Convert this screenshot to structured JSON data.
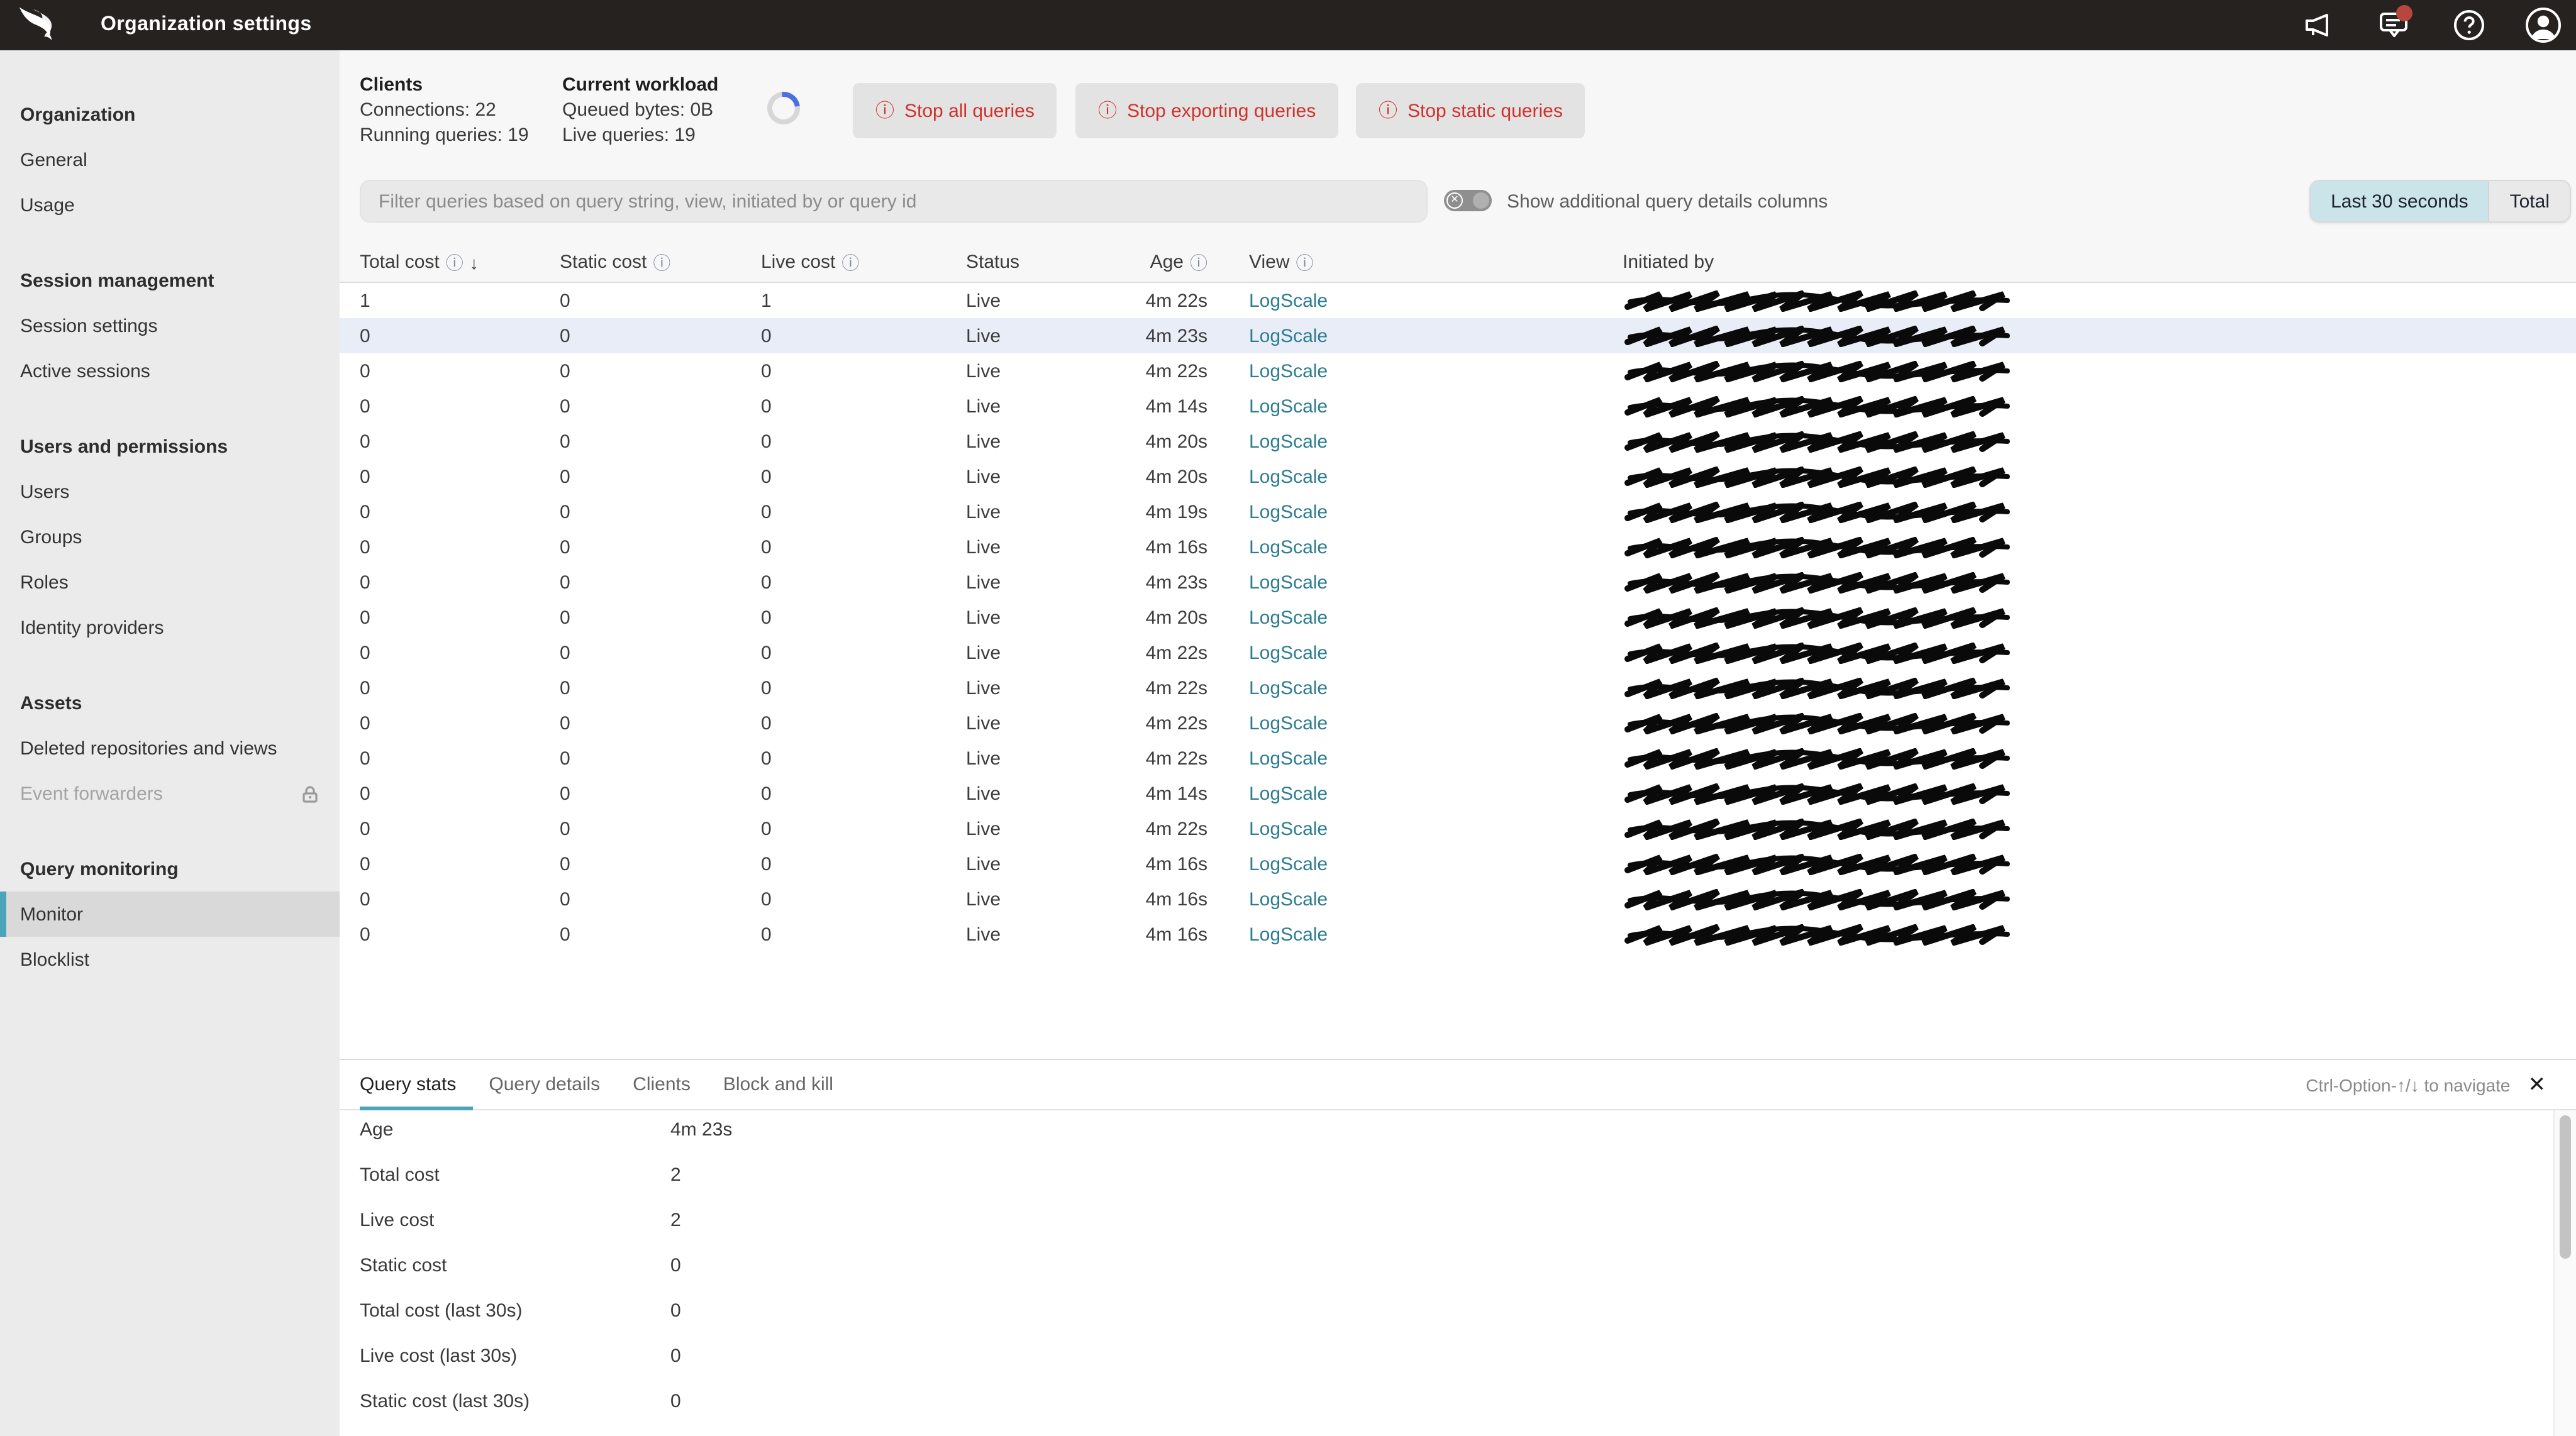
{
  "topbar": {
    "title": "Organization settings",
    "logo": "CrowdStrike falcon",
    "icons": [
      "megaphone-icon",
      "notifications-icon",
      "help-icon",
      "account-icon"
    ],
    "notifications_badge": true
  },
  "sidebar": {
    "sections": [
      {
        "header": "Organization",
        "items": [
          {
            "label": "General"
          },
          {
            "label": "Usage"
          }
        ]
      },
      {
        "header": "Session management",
        "items": [
          {
            "label": "Session settings"
          },
          {
            "label": "Active sessions"
          }
        ]
      },
      {
        "header": "Users and permissions",
        "items": [
          {
            "label": "Users"
          },
          {
            "label": "Groups"
          },
          {
            "label": "Roles"
          },
          {
            "label": "Identity providers"
          }
        ]
      },
      {
        "header": "Assets",
        "items": [
          {
            "label": "Deleted repositories and views"
          },
          {
            "label": "Event forwarders",
            "disabled": true,
            "lock": true
          }
        ]
      },
      {
        "header": "Query monitoring",
        "items": [
          {
            "label": "Monitor",
            "selected": true
          },
          {
            "label": "Blocklist"
          }
        ]
      }
    ]
  },
  "stats": {
    "clients": {
      "title": "Clients",
      "line1": "Connections: 22",
      "line2": "Running queries: 19"
    },
    "workload": {
      "title": "Current workload",
      "line1": "Queued bytes: 0B",
      "line2": "Live queries: 19"
    }
  },
  "actions": {
    "stop_all": "Stop all queries",
    "stop_exporting": "Stop exporting queries",
    "stop_static": "Stop static queries"
  },
  "filter": {
    "placeholder": "Filter queries based on query string, view, initiated by or query id"
  },
  "toggle": {
    "label": "Show additional query details columns",
    "state": "off"
  },
  "range_selector": {
    "options": [
      "Last 30 seconds",
      "Total"
    ],
    "selected": "Last 30 seconds"
  },
  "table": {
    "columns": [
      {
        "label": "Total cost",
        "info": true,
        "sort": "desc"
      },
      {
        "label": "Static cost",
        "info": true
      },
      {
        "label": "Live cost",
        "info": true
      },
      {
        "label": "Status"
      },
      {
        "label": "Age",
        "info": true
      },
      {
        "label": "View",
        "info": true
      },
      {
        "label": "Initiated by"
      }
    ],
    "selected_row_index": 1,
    "rows": [
      {
        "total": "1",
        "static": "0",
        "live": "1",
        "status": "Live",
        "age": "4m 22s",
        "view": "LogScale",
        "initiated": "redacted"
      },
      {
        "total": "0",
        "static": "0",
        "live": "0",
        "status": "Live",
        "age": "4m 23s",
        "view": "LogScale",
        "initiated": "redacted"
      },
      {
        "total": "0",
        "static": "0",
        "live": "0",
        "status": "Live",
        "age": "4m 22s",
        "view": "LogScale",
        "initiated": "redacted"
      },
      {
        "total": "0",
        "static": "0",
        "live": "0",
        "status": "Live",
        "age": "4m 14s",
        "view": "LogScale",
        "initiated": "redacted"
      },
      {
        "total": "0",
        "static": "0",
        "live": "0",
        "status": "Live",
        "age": "4m 20s",
        "view": "LogScale",
        "initiated": "redacted"
      },
      {
        "total": "0",
        "static": "0",
        "live": "0",
        "status": "Live",
        "age": "4m 20s",
        "view": "LogScale",
        "initiated": "redacted"
      },
      {
        "total": "0",
        "static": "0",
        "live": "0",
        "status": "Live",
        "age": "4m 19s",
        "view": "LogScale",
        "initiated": "redacted"
      },
      {
        "total": "0",
        "static": "0",
        "live": "0",
        "status": "Live",
        "age": "4m 16s",
        "view": "LogScale",
        "initiated": "redacted"
      },
      {
        "total": "0",
        "static": "0",
        "live": "0",
        "status": "Live",
        "age": "4m 23s",
        "view": "LogScale",
        "initiated": "redacted"
      },
      {
        "total": "0",
        "static": "0",
        "live": "0",
        "status": "Live",
        "age": "4m 20s",
        "view": "LogScale",
        "initiated": "redacted"
      },
      {
        "total": "0",
        "static": "0",
        "live": "0",
        "status": "Live",
        "age": "4m 22s",
        "view": "LogScale",
        "initiated": "redacted"
      },
      {
        "total": "0",
        "static": "0",
        "live": "0",
        "status": "Live",
        "age": "4m 22s",
        "view": "LogScale",
        "initiated": "redacted"
      },
      {
        "total": "0",
        "static": "0",
        "live": "0",
        "status": "Live",
        "age": "4m 22s",
        "view": "LogScale",
        "initiated": "redacted"
      },
      {
        "total": "0",
        "static": "0",
        "live": "0",
        "status": "Live",
        "age": "4m 22s",
        "view": "LogScale",
        "initiated": "redacted"
      },
      {
        "total": "0",
        "static": "0",
        "live": "0",
        "status": "Live",
        "age": "4m 14s",
        "view": "LogScale",
        "initiated": "redacted"
      },
      {
        "total": "0",
        "static": "0",
        "live": "0",
        "status": "Live",
        "age": "4m 22s",
        "view": "LogScale",
        "initiated": "redacted"
      },
      {
        "total": "0",
        "static": "0",
        "live": "0",
        "status": "Live",
        "age": "4m 16s",
        "view": "LogScale",
        "initiated": "redacted"
      },
      {
        "total": "0",
        "static": "0",
        "live": "0",
        "status": "Live",
        "age": "4m 16s",
        "view": "LogScale",
        "initiated": "redacted"
      },
      {
        "total": "0",
        "static": "0",
        "live": "0",
        "status": "Live",
        "age": "4m 16s",
        "view": "LogScale",
        "initiated": "redacted"
      }
    ]
  },
  "detail_panel": {
    "tabs": [
      "Query stats",
      "Query details",
      "Clients",
      "Block and kill"
    ],
    "active_tab": "Query stats",
    "shortcut_hint": "Ctrl-Option-↑/↓ to navigate",
    "close_label": "✕",
    "rows": [
      {
        "label": "Age",
        "value": "4m 23s"
      },
      {
        "label": "Total cost",
        "value": "2"
      },
      {
        "label": "Live cost",
        "value": "2"
      },
      {
        "label": "Static cost",
        "value": "0"
      },
      {
        "label": "Total cost (last 30s)",
        "value": "0"
      },
      {
        "label": "Live cost (last 30s)",
        "value": "0"
      },
      {
        "label": "Static cost (last 30s)",
        "value": "0"
      }
    ]
  },
  "colors": {
    "topbar_bg": "#252220",
    "accent_teal": "#4aa5b8",
    "link": "#2d7d8f",
    "danger_red": "#cf322c",
    "selected_row_bg": "#e9edf8",
    "range_selected_bg": "#cbe4ea",
    "badge_red": "#b7473c"
  }
}
